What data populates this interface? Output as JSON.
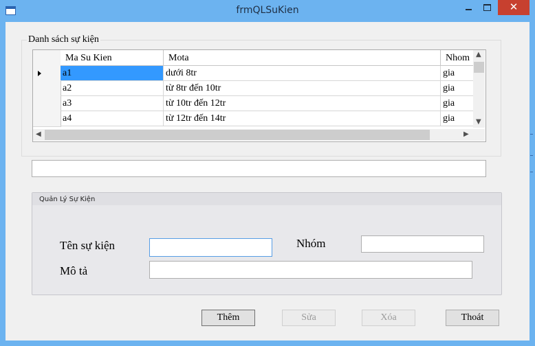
{
  "window": {
    "title": "frmQLSuKien"
  },
  "events_group": {
    "title": "Danh sách sự kiện",
    "columns": [
      "Ma Su Kien",
      "Mota",
      "Nhom"
    ],
    "rows": [
      {
        "ma": "a1",
        "mota": "dưới 8tr",
        "nhom": "gia"
      },
      {
        "ma": "a2",
        "mota": "từ 8tr  đến 10tr",
        "nhom": "gia"
      },
      {
        "ma": "a3",
        "mota": "từ 10tr  đến 12tr",
        "nhom": "gia"
      },
      {
        "ma": "a4",
        "mota": "từ 12tr  đến 14tr",
        "nhom": "gia"
      }
    ]
  },
  "search": {
    "value": ""
  },
  "manage_group": {
    "title": "Quản Lý Sự Kiện",
    "name_label": "Tên sự kiện",
    "name_value": "",
    "group_label": "Nhóm",
    "group_value": "",
    "desc_label": "Mô tả",
    "desc_value": ""
  },
  "buttons": {
    "add": "Thêm",
    "edit": "Sửa",
    "delete": "Xóa",
    "exit": "Thoát"
  },
  "colors": {
    "titlebar": "#6cb3f0",
    "close": "#c7402f",
    "selection": "#3399ff"
  }
}
